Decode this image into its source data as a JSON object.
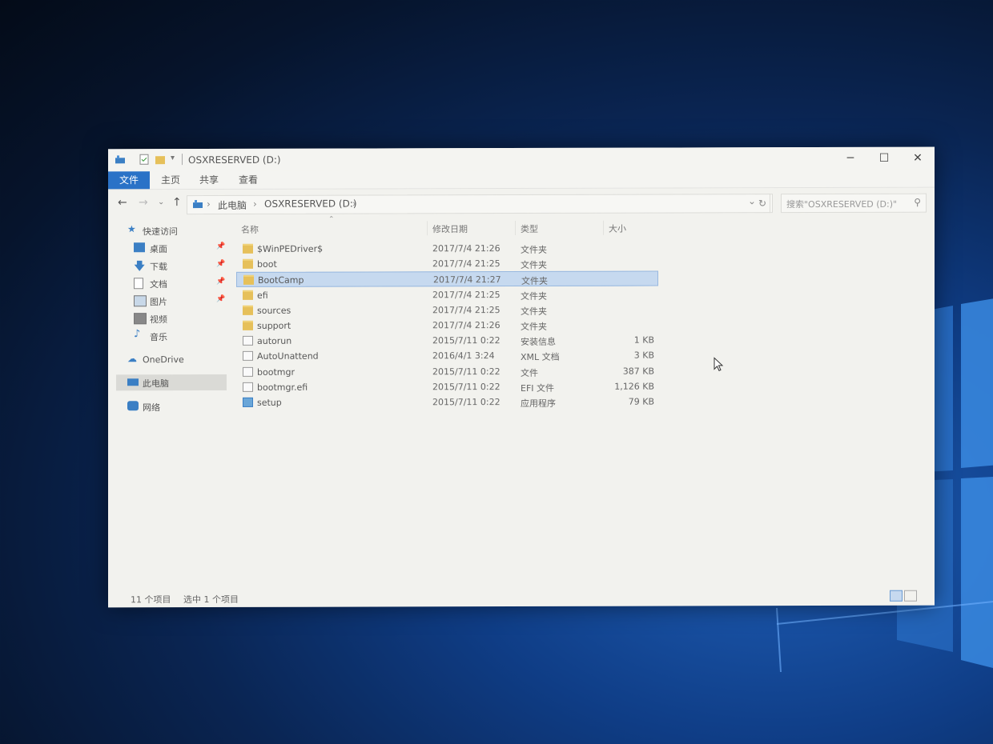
{
  "window": {
    "title": "OSXRESERVED (D:)",
    "minimize": "─",
    "maximize": "☐",
    "close": "✕"
  },
  "ribbon": {
    "tabs": [
      "文件",
      "主页",
      "共享",
      "查看"
    ]
  },
  "nav": {
    "back": "←",
    "forward": "→",
    "recent": "⌄",
    "up": "↑",
    "breadcrumb": [
      "此电脑",
      "OSXRESERVED (D:)"
    ],
    "separator": "›",
    "refresh": "↻",
    "dropdown": "⌄"
  },
  "search": {
    "placeholder": "搜索\"OSXRESERVED (D:)\"",
    "icon": "search-icon"
  },
  "sidebar": {
    "quick_access": "快速访问",
    "items": [
      {
        "label": "桌面",
        "icon": "desktop-icon",
        "pinned": true
      },
      {
        "label": "下载",
        "icon": "download-icon",
        "pinned": true
      },
      {
        "label": "文档",
        "icon": "document-icon",
        "pinned": true
      },
      {
        "label": "图片",
        "icon": "picture-icon",
        "pinned": true
      },
      {
        "label": "视频",
        "icon": "video-icon",
        "pinned": false
      },
      {
        "label": "音乐",
        "icon": "music-icon",
        "pinned": false
      }
    ],
    "onedrive": "OneDrive",
    "this_pc": "此电脑",
    "network": "网络"
  },
  "columns": {
    "name": "名称",
    "modified": "修改日期",
    "type": "类型",
    "size": "大小"
  },
  "files": [
    {
      "name": "$WinPEDriver$",
      "modified": "2017/7/4 21:26",
      "type": "文件夹",
      "size": "",
      "kind": "folder"
    },
    {
      "name": "boot",
      "modified": "2017/7/4 21:25",
      "type": "文件夹",
      "size": "",
      "kind": "folder"
    },
    {
      "name": "BootCamp",
      "modified": "2017/7/4 21:27",
      "type": "文件夹",
      "size": "",
      "kind": "folder",
      "selected": true
    },
    {
      "name": "efi",
      "modified": "2017/7/4 21:25",
      "type": "文件夹",
      "size": "",
      "kind": "folder"
    },
    {
      "name": "sources",
      "modified": "2017/7/4 21:25",
      "type": "文件夹",
      "size": "",
      "kind": "folder"
    },
    {
      "name": "support",
      "modified": "2017/7/4 21:26",
      "type": "文件夹",
      "size": "",
      "kind": "folder"
    },
    {
      "name": "autorun",
      "modified": "2015/7/11 0:22",
      "type": "安装信息",
      "size": "1 KB",
      "kind": "file"
    },
    {
      "name": "AutoUnattend",
      "modified": "2016/4/1 3:24",
      "type": "XML 文档",
      "size": "3 KB",
      "kind": "file"
    },
    {
      "name": "bootmgr",
      "modified": "2015/7/11 0:22",
      "type": "文件",
      "size": "387 KB",
      "kind": "file"
    },
    {
      "name": "bootmgr.efi",
      "modified": "2015/7/11 0:22",
      "type": "EFI 文件",
      "size": "1,126 KB",
      "kind": "file"
    },
    {
      "name": "setup",
      "modified": "2015/7/11 0:22",
      "type": "应用程序",
      "size": "79 KB",
      "kind": "app"
    }
  ],
  "status": {
    "item_count": "11 个项目",
    "selected": "选中 1 个项目"
  },
  "colors": {
    "accent": "#2a72c7",
    "selection": "#c6d9ef",
    "folder": "#e6c05a"
  }
}
